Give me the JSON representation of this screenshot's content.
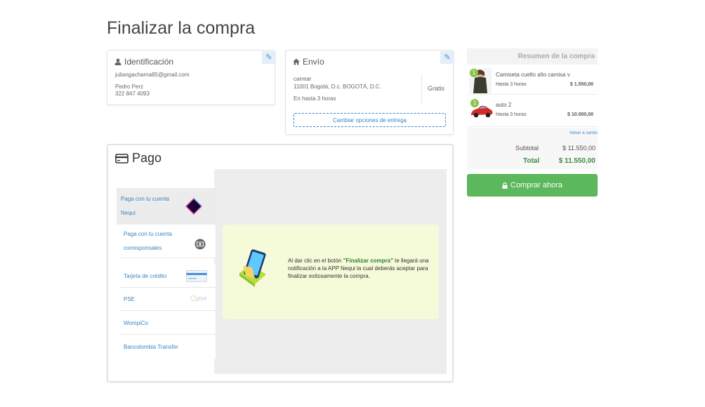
{
  "page": {
    "title": "Finalizar la compra"
  },
  "identification": {
    "heading": "Identificación",
    "email": "juliangacharna85@gmail.com",
    "name": "Pedro Perz",
    "phone": "322 847 4093"
  },
  "shipping": {
    "heading": "Envío",
    "address_line1": "carrear",
    "address_line2": "11001 Bogotá, D.c. BOGOTÁ, D.C.",
    "eta": "En hasta 3 horas",
    "price": "Gratis",
    "change_button": "Cambiar opciones de entrega"
  },
  "payment": {
    "heading": "Pago",
    "methods": [
      {
        "label": "Paga con tu cuenta Nequi"
      },
      {
        "label": "Paga con tu cuenta corresponsales"
      },
      {
        "label": "Tarjeta de crédito"
      },
      {
        "label": "PSE",
        "logo_text": "pse"
      },
      {
        "label": "WompiCo"
      },
      {
        "label": "Bancolombia Transfer"
      }
    ],
    "nequi_message_pre": "Al dar clic en el botón ",
    "nequi_message_highlight": "\"Finalizar compra\"",
    "nequi_message_post": " te llegará una notificación a la APP Nequi la cual deberás aceptar para finalizar exitosamente la compra."
  },
  "summary": {
    "heading": "Resumen de la compra",
    "items": [
      {
        "qty": "1",
        "name": "Camiseta cuello alto camisa v",
        "eta": "Hasta 3 horas",
        "price": "$ 1.550,00"
      },
      {
        "qty": "1",
        "name": "auto 2",
        "eta": "Hasta 3 horas",
        "price": "$ 10.000,00"
      }
    ],
    "back_link": "Volver a carrito",
    "subtotal_label": "Subtotal",
    "subtotal_value": "$ 11.550,00",
    "total_label": "Total",
    "total_value": "$ 11.550,00",
    "buy_button": "Comprar ahora"
  },
  "colors": {
    "accent": "#5cb85c",
    "link": "#3a85c8",
    "highlight": "#2e7d32",
    "nequi_bg": "#f5fbd9"
  }
}
